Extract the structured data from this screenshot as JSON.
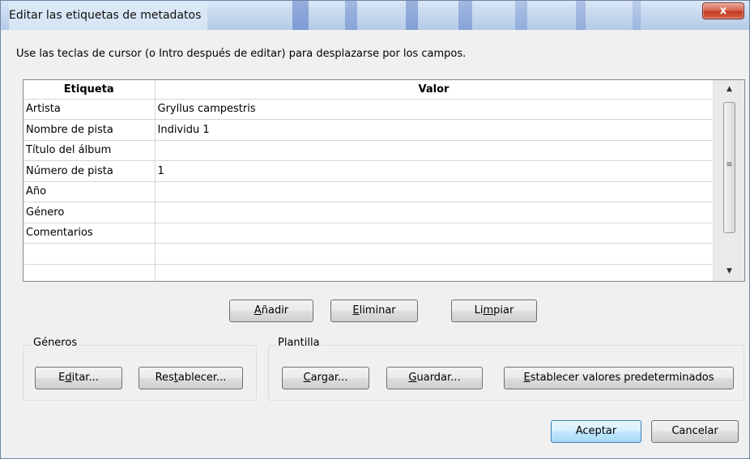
{
  "window": {
    "title": "Editar las etiquetas de metadatos",
    "close_label": "x"
  },
  "instructions": "Use las teclas de cursor (o Intro después de editar) para desplazarse por los campos.",
  "table": {
    "headers": [
      "Etiqueta",
      "Valor"
    ],
    "rows": [
      {
        "tag": "Artista",
        "value": "Gryllus campestris"
      },
      {
        "tag": "Nombre de pista",
        "value": "Individu 1"
      },
      {
        "tag": "Título del álbum",
        "value": ""
      },
      {
        "tag": "Número de pista",
        "value": "1"
      },
      {
        "tag": "Año",
        "value": ""
      },
      {
        "tag": "Género",
        "value": ""
      },
      {
        "tag": "Comentarios",
        "value": ""
      },
      {
        "tag": "",
        "value": ""
      },
      {
        "tag": "",
        "value": ""
      }
    ]
  },
  "scrollbar": {
    "up_glyph": "▲",
    "down_glyph": "▼",
    "grip_glyph": "≡"
  },
  "actions": {
    "add": {
      "label_pre": "",
      "label_ul": "A",
      "label_post": "ñadir"
    },
    "remove": {
      "label_pre": "",
      "label_ul": "E",
      "label_post": "liminar"
    },
    "clear": {
      "label_pre": "Li",
      "label_ul": "m",
      "label_post": "piar"
    }
  },
  "genres": {
    "label": "Géneros",
    "edit": {
      "label_pre": "E",
      "label_ul": "d",
      "label_post": "itar..."
    },
    "reset": {
      "label_pre": "Res",
      "label_ul": "t",
      "label_post": "ablecer..."
    }
  },
  "template": {
    "label": "Plantilla",
    "load": {
      "label_pre": "",
      "label_ul": "C",
      "label_post": "argar..."
    },
    "save": {
      "label_pre": "",
      "label_ul": "G",
      "label_post": "uardar..."
    },
    "set_defaults": {
      "label_pre": "",
      "label_ul": "E",
      "label_post": "stablecer valores predeterminados"
    }
  },
  "footer": {
    "ok": "Aceptar",
    "cancel": "Cancelar"
  },
  "colors": {
    "default_button_border": "#3c7fb1",
    "close_button": "#c43a22"
  }
}
